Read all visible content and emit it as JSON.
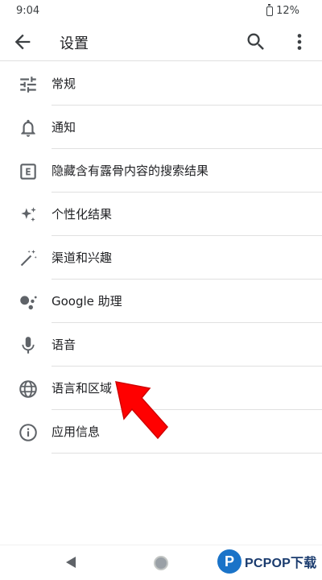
{
  "status": {
    "time": "9:04",
    "battery": "12%"
  },
  "app_bar": {
    "title": "设置"
  },
  "items": [
    {
      "label": "常规",
      "icon": "tune-icon"
    },
    {
      "label": "通知",
      "icon": "bell-icon"
    },
    {
      "label": "隐藏含有露骨内容的搜索结果",
      "icon": "explicit-icon"
    },
    {
      "label": "个性化结果",
      "icon": "sparkle-icon"
    },
    {
      "label": "渠道和兴趣",
      "icon": "magic-wand-icon"
    },
    {
      "label": "Google 助理",
      "icon": "assistant-icon"
    },
    {
      "label": "语音",
      "icon": "microphone-icon"
    },
    {
      "label": "语言和区域",
      "icon": "globe-icon"
    },
    {
      "label": "应用信息",
      "icon": "info-icon"
    }
  ],
  "watermark": {
    "text": "PCPOP下载",
    "logo_letter": "P"
  },
  "colors": {
    "annotation_arrow": "#ff0000",
    "icon": "#5f6368",
    "watermark": "#1a73c8"
  }
}
